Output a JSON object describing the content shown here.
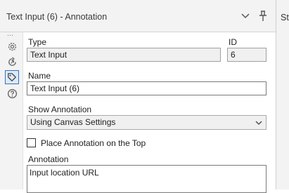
{
  "panel": {
    "title": "Text Input (6) - Annotation",
    "right_tab_label": "St"
  },
  "sidebar": {
    "overflow_label": "...",
    "items": [
      {
        "name": "configuration",
        "icon": "gear-icon"
      },
      {
        "name": "layout",
        "icon": "connection-rotate-icon"
      },
      {
        "name": "annotation",
        "icon": "tag-icon",
        "active": true
      },
      {
        "name": "help",
        "icon": "question-circle-icon"
      }
    ]
  },
  "form": {
    "type_label": "Type",
    "type_value": "Text Input",
    "id_label": "ID",
    "id_value": "6",
    "name_label": "Name",
    "name_value": "Text Input (6)",
    "show_annotation_label": "Show Annotation",
    "show_annotation_value": "Using Canvas Settings",
    "place_on_top_label": "Place Annotation on the Top",
    "place_on_top_checked": false,
    "annotation_label": "Annotation",
    "annotation_value": "Input location URL"
  },
  "colors": {
    "header_bg": "#f3f3f3",
    "active_icon_border": "#2d74c2",
    "icon_gray": "#6b6b6b"
  }
}
